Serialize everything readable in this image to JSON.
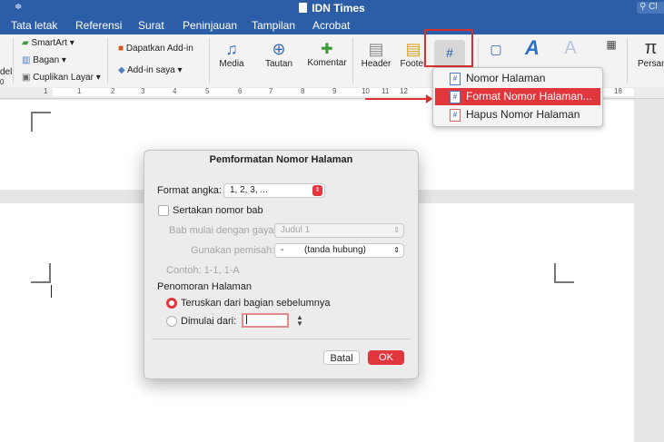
{
  "window": {
    "title": "IDN Times",
    "search_placeholder": "Cl"
  },
  "tabs": [
    "Tata letak",
    "Referensi",
    "Surat",
    "Peninjauan",
    "Tampilan",
    "Acrobat"
  ],
  "ribbon": {
    "left_cut_labels": [
      "del",
      "0"
    ],
    "smartart": "SmartArt",
    "bagan": "Bagan",
    "cuplikan": "Cuplikan Layar",
    "get_addin": "Dapatkan Add-in",
    "my_addin": "Add-in saya",
    "media": "Media",
    "tautan": "Tautan",
    "komentar": "Komentar",
    "header": "Header",
    "footer": "Footer",
    "page_number_icon": "#",
    "text_icon": "A",
    "equation": "Persam"
  },
  "ruler": [
    "1",
    "2",
    "1",
    "1",
    "2",
    "3",
    "4",
    "5",
    "6",
    "7",
    "8",
    "9",
    "10",
    "11",
    "12",
    "18"
  ],
  "dropdown": {
    "items": [
      "Nomor Halaman",
      "Format Nomor Halaman...",
      "Hapus Nomor Halaman"
    ],
    "icon_glyph": "#"
  },
  "dialog": {
    "title": "Pemformatan Nomor Halaman",
    "format_label": "Format angka:",
    "format_value": "1, 2, 3, ...",
    "include_chapter": "Sertakan nomor bab",
    "chapter_style_label": "Bab mulai dengan gaya:",
    "chapter_style_value": "Judul 1",
    "separator_label": "Gunakan pemisah:",
    "separator_value": "-",
    "separator_desc": "(tanda hubung)",
    "example": "Contoh:  1-1, 1-A",
    "numbering_header": "Penomoran Halaman",
    "continue_label": "Teruskan dari bagian sebelumnya",
    "start_at_label": "Dimulai dari:",
    "start_at_value": "",
    "cancel": "Batal",
    "ok": "OK"
  },
  "colors": {
    "brand": "#2c5ea8",
    "accent_red": "#e0363c"
  }
}
